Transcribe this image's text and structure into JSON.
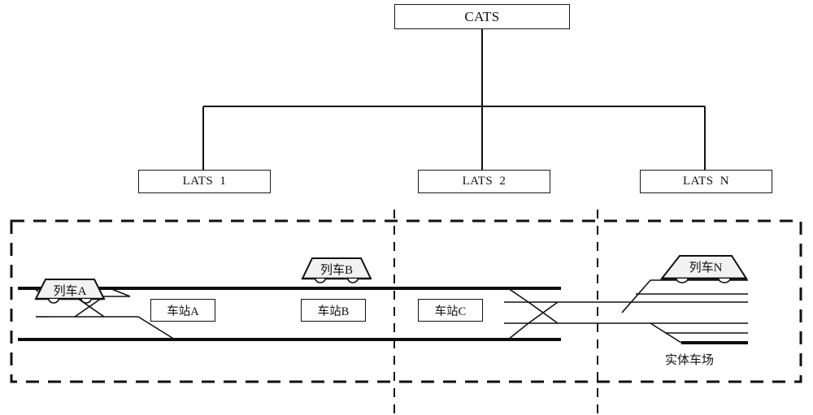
{
  "diagram": {
    "title_nodes": {
      "central": {
        "label": "CATS"
      },
      "locals": [
        {
          "label": "LATS  1"
        },
        {
          "label": "LATS  2"
        },
        {
          "label": "LATS  N"
        }
      ]
    },
    "stations": [
      {
        "label": "车站A"
      },
      {
        "label": "车站B"
      },
      {
        "label": "车站C"
      }
    ],
    "trains": [
      {
        "label": "列车A"
      },
      {
        "label": "列车B"
      },
      {
        "label": "列车N"
      }
    ],
    "depot": {
      "caption": "实体车场"
    },
    "colors": {
      "line": "#111111",
      "box_border": "#1a1a1a",
      "background": "#ffffff",
      "train_fill": "#f2f2f2",
      "dashed_border": "#111111"
    }
  },
  "chart_data": {
    "type": "diagram",
    "title": "CATS / LATS train supervision hierarchy over a physical railway line",
    "nodes": [
      {
        "id": "cats",
        "label": "CATS",
        "level": 0
      },
      {
        "id": "lats1",
        "label": "LATS  1",
        "level": 1
      },
      {
        "id": "lats2",
        "label": "LATS  2",
        "level": 1
      },
      {
        "id": "latsn",
        "label": "LATS  N",
        "level": 1
      }
    ],
    "edges": [
      {
        "from": "cats",
        "to": "lats1"
      },
      {
        "from": "cats",
        "to": "lats2"
      },
      {
        "from": "cats",
        "to": "latsn"
      }
    ],
    "field_elements": {
      "stations": [
        "车站A",
        "车站B",
        "车站C"
      ],
      "trains": [
        "列车A",
        "列车B",
        "列车N"
      ],
      "depot": "实体车场",
      "zone_dividers": 2,
      "crossovers": 2,
      "depot_sidings": 6
    }
  }
}
